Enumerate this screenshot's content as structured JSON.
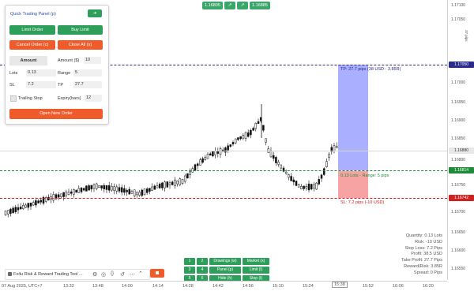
{
  "top_pills": {
    "bid": "1.16805",
    "ask": "1.16885",
    "icon_a": "pin-icon",
    "icon_b": "pin-icon"
  },
  "panel": {
    "title": "Quick Trading Panel (p)",
    "expand_icon": "arrow-right-icon",
    "limit_order": "Limit Order",
    "buy_limit": "Buy Limit",
    "cancel_order": "Cancel Order (c)",
    "close_all": "Close All (x)",
    "amount_tab": "Amount",
    "amount_label": "Amount ($)",
    "amount_value": "10",
    "lots_label": "Lots",
    "lots_value": "0.13",
    "range_label": "Range",
    "range_value": "5",
    "sl_label": "SL",
    "sl_value": "7.2",
    "tp_label": "TP",
    "tp_value": "27.7",
    "trailing_stop_label": "Trailing Stop",
    "expiry_label": "Expiry(bars)",
    "expiry_value": "12",
    "open_new_order": "Open New Order"
  },
  "annotations": {
    "tp": "TP: 27.7 pips (38 USD - 3.85R)",
    "entry": "0.13 Lots - Range: 5 pips",
    "sl": "SL: 7.2 pips (-10 USD)"
  },
  "price_axis": {
    "ticks": [
      "1.17100",
      "1.17050",
      "1.17000",
      "1.16950",
      "1.16900",
      "1.16850",
      "1.16800",
      "1.16750",
      "1.16700",
      "1.16650",
      "1.16600",
      "1.16550"
    ],
    "tp_tag": "1.17050",
    "current_tag": "1.16880",
    "entry_tag": "1.16814",
    "sl_tag": "1.16742",
    "side_label": "37 pips"
  },
  "time_axis": {
    "start": "07 Aug 2025, UTC+7",
    "ticks": [
      "13:32",
      "13:48",
      "14:00",
      "14:14",
      "14:28",
      "14:42",
      "14:56",
      "15:10",
      "15:24",
      "15:38",
      "15:52",
      "16:06",
      "16:20"
    ],
    "cursor_label": "15:38"
  },
  "stats": [
    "Quantity: 0.13 Lots",
    "Risk: -10 USD",
    "Stop Loss: 7.2 Pips",
    "Profit: 38.5 USD",
    "Take Profit: 27.7 Pips",
    "Reward/Risk: 3.85R",
    "Spread: 0 Pips"
  ],
  "bottom_buttons": {
    "k1": "1",
    "k2": "2",
    "k3": "3",
    "k4": "4",
    "k5": "5",
    "k6": "6",
    "drawings": "Drawings (w)",
    "market": "Market (s)",
    "panel": "Panel (p)",
    "limit": "Limit (l)",
    "hide": "Hide (h)",
    "stop": "Stop (t)",
    "action_icon": "stop-square-icon"
  },
  "indicator": {
    "name": "Fx4u Risk & Reward Trading Tool ...",
    "icons": [
      "settings-icon",
      "eye-icon",
      "code-icon",
      "history-icon",
      "more-icon"
    ]
  },
  "colors": {
    "tp_line": "#2a2a8a",
    "entry_line": "#1f8a3a",
    "sl_line": "#d02020",
    "tp_zone": "#aab0ff",
    "sl_zone": "#f7a3a3",
    "green": "#2e9e5b",
    "orange": "#ef5b2a"
  }
}
